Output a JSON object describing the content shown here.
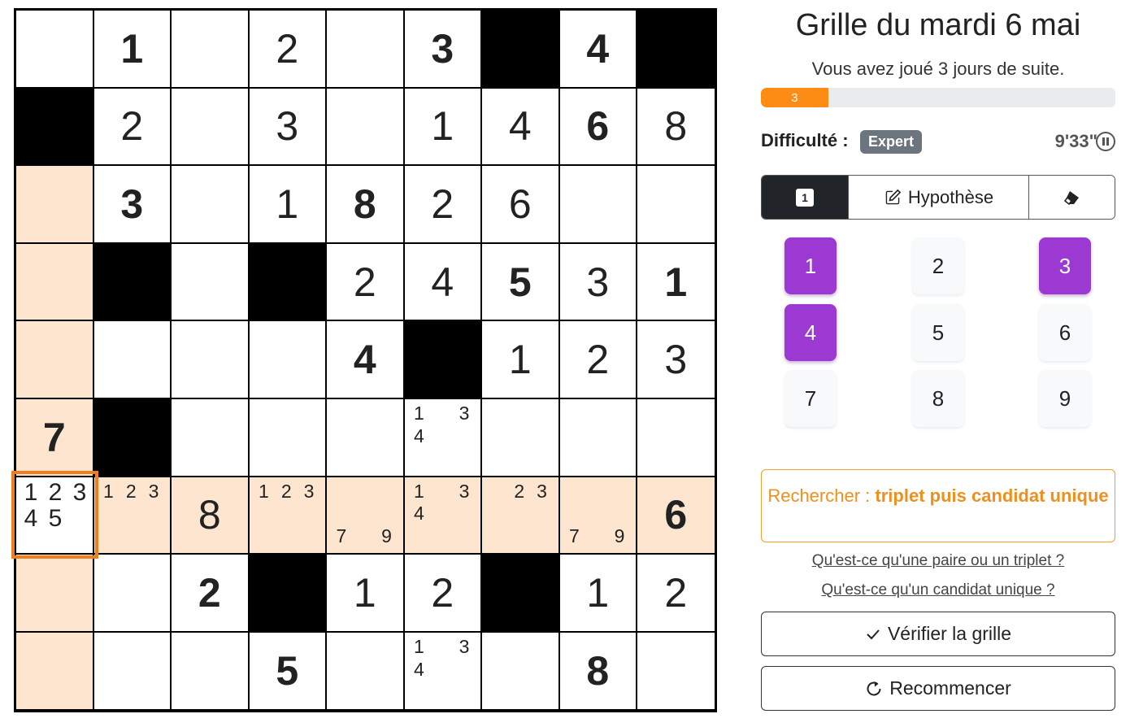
{
  "grid": {
    "rows": [
      [
        {
          "t": "empty"
        },
        {
          "t": "given",
          "v": "1"
        },
        {
          "t": "empty"
        },
        {
          "t": "user",
          "v": "2"
        },
        {
          "t": "empty"
        },
        {
          "t": "given",
          "v": "3"
        },
        {
          "t": "black"
        },
        {
          "t": "given",
          "v": "4"
        },
        {
          "t": "black"
        }
      ],
      [
        {
          "t": "black"
        },
        {
          "t": "user",
          "v": "2"
        },
        {
          "t": "empty"
        },
        {
          "t": "user",
          "v": "3"
        },
        {
          "t": "empty"
        },
        {
          "t": "user",
          "v": "1"
        },
        {
          "t": "user",
          "v": "4"
        },
        {
          "t": "given",
          "v": "6"
        },
        {
          "t": "user",
          "v": "8"
        }
      ],
      [
        {
          "t": "empty",
          "hl": true
        },
        {
          "t": "given",
          "v": "3"
        },
        {
          "t": "empty"
        },
        {
          "t": "user",
          "v": "1"
        },
        {
          "t": "given",
          "v": "8"
        },
        {
          "t": "user",
          "v": "2"
        },
        {
          "t": "user",
          "v": "6"
        },
        {
          "t": "empty"
        },
        {
          "t": "empty"
        }
      ],
      [
        {
          "t": "empty",
          "hl": true
        },
        {
          "t": "black"
        },
        {
          "t": "empty"
        },
        {
          "t": "black"
        },
        {
          "t": "user",
          "v": "2"
        },
        {
          "t": "user",
          "v": "4"
        },
        {
          "t": "given",
          "v": "5"
        },
        {
          "t": "user",
          "v": "3"
        },
        {
          "t": "given",
          "v": "1"
        }
      ],
      [
        {
          "t": "empty",
          "hl": true
        },
        {
          "t": "empty"
        },
        {
          "t": "empty"
        },
        {
          "t": "empty"
        },
        {
          "t": "given",
          "v": "4"
        },
        {
          "t": "black"
        },
        {
          "t": "user",
          "v": "1"
        },
        {
          "t": "user",
          "v": "2"
        },
        {
          "t": "user",
          "v": "3"
        }
      ],
      [
        {
          "t": "given",
          "v": "7",
          "hl": true
        },
        {
          "t": "black"
        },
        {
          "t": "empty"
        },
        {
          "t": "empty"
        },
        {
          "t": "empty"
        },
        {
          "t": "notes",
          "n": [
            "1",
            "",
            "3",
            "4",
            "",
            "",
            "",
            "",
            ""
          ]
        },
        {
          "t": "empty"
        },
        {
          "t": "empty"
        },
        {
          "t": "empty"
        }
      ],
      [
        {
          "t": "selected",
          "hl": true
        },
        {
          "t": "notes",
          "n": [
            "1",
            "2",
            "3",
            "",
            "",
            "",
            "",
            "",
            ""
          ],
          "hl": true
        },
        {
          "t": "user",
          "v": "8",
          "hl": true
        },
        {
          "t": "notes",
          "n": [
            "1",
            "2",
            "3",
            "",
            "",
            "",
            "",
            "",
            ""
          ],
          "hl": true
        },
        {
          "t": "notes",
          "n": [
            "",
            "",
            "",
            "",
            "",
            "",
            "7",
            "",
            "9"
          ],
          "hl": true
        },
        {
          "t": "notes",
          "n": [
            "1",
            "",
            "3",
            "4",
            "",
            "",
            "",
            "",
            ""
          ],
          "hl": true
        },
        {
          "t": "notes",
          "n": [
            "",
            "2",
            "3",
            "",
            "",
            "",
            "",
            "",
            ""
          ],
          "hl": true
        },
        {
          "t": "notes",
          "n": [
            "",
            "",
            "",
            "",
            "",
            "",
            "7",
            "",
            "9"
          ],
          "hl": true
        },
        {
          "t": "given",
          "v": "6",
          "hl": true
        }
      ],
      [
        {
          "t": "empty",
          "hl": true
        },
        {
          "t": "empty"
        },
        {
          "t": "given",
          "v": "2"
        },
        {
          "t": "black"
        },
        {
          "t": "user",
          "v": "1"
        },
        {
          "t": "user",
          "v": "2"
        },
        {
          "t": "black"
        },
        {
          "t": "user",
          "v": "1"
        },
        {
          "t": "user",
          "v": "2"
        }
      ],
      [
        {
          "t": "empty",
          "hl": true
        },
        {
          "t": "empty"
        },
        {
          "t": "empty"
        },
        {
          "t": "given",
          "v": "5"
        },
        {
          "t": "empty"
        },
        {
          "t": "notes",
          "n": [
            "1",
            "",
            "3",
            "4",
            "",
            "",
            "",
            "",
            ""
          ]
        },
        {
          "t": "empty"
        },
        {
          "t": "given",
          "v": "8"
        },
        {
          "t": "empty"
        }
      ]
    ],
    "selected_notes": [
      "1",
      "2",
      "3",
      "4",
      "5",
      ""
    ]
  },
  "panel": {
    "title": "Grille du mardi 6 mai",
    "streak_text": "Vous avez joué 3 jours de suite.",
    "progress_label": "3",
    "progress_fraction": 0.19,
    "difficulty_label": "Difficulté :",
    "difficulty_value": "Expert",
    "timer": "9'33\"",
    "modes": {
      "normal_key": "1",
      "hypothesis_label": "Hypothèse"
    },
    "numpad": [
      {
        "label": "1",
        "active": true
      },
      {
        "label": "2",
        "active": false
      },
      {
        "label": "3",
        "active": true
      },
      {
        "label": "4",
        "active": true
      },
      {
        "label": "5",
        "active": false
      },
      {
        "label": "6",
        "active": false
      },
      {
        "label": "7",
        "active": false
      },
      {
        "label": "8",
        "active": false
      },
      {
        "label": "9",
        "active": false
      }
    ],
    "hint_prefix": "Rechercher :",
    "hint_strategy": "triplet puis candidat unique",
    "link_pair": "Qu'est-ce qu'une paire ou un triplet ?",
    "link_single": "Qu'est-ce qu'un candidat unique ?",
    "check_label": "Vérifier la grille",
    "restart_label": "Recommencer"
  },
  "colors": {
    "accent_orange": "#f07d1e",
    "highlight": "#fde5cf",
    "numpad_active": "#9b39d2"
  }
}
